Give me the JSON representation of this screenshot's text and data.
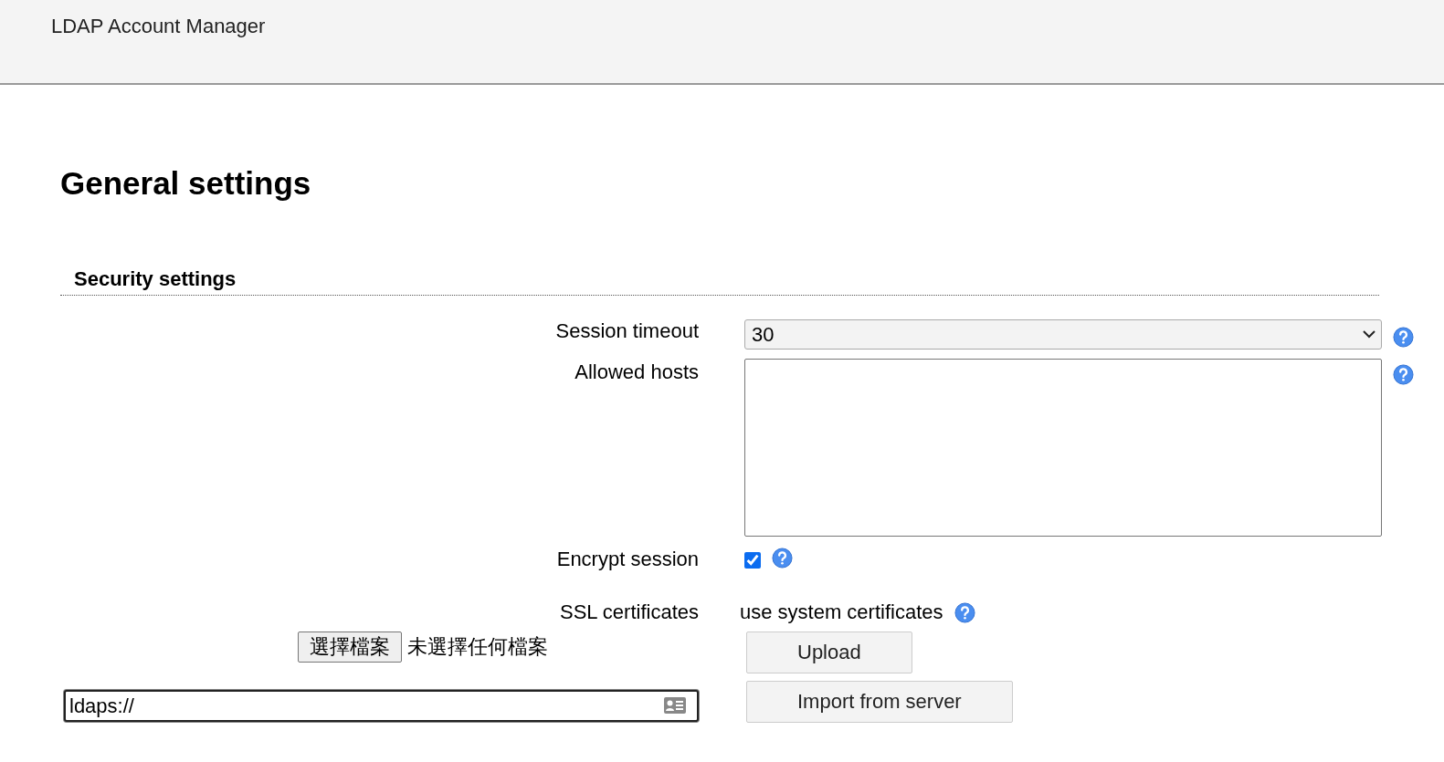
{
  "app_title": "LDAP Account Manager",
  "page_title": "General settings",
  "section_title": "Security settings",
  "settings": [
    {
      "kind": "select",
      "label": "Session timeout",
      "value": "30",
      "help": true
    },
    {
      "kind": "textarea",
      "label": "Allowed hosts",
      "help": true
    },
    {
      "kind": "checkbox",
      "label": "Encrypt session",
      "checked": true,
      "help": true
    },
    {
      "kind": "text",
      "label": "SSL certificates",
      "value": "use system certificates",
      "help": true
    }
  ],
  "file_upload": {
    "choose_button": "選擇檔案",
    "status": "未選擇任何檔案",
    "upload_button": "Upload"
  },
  "server_import": {
    "value": "ldaps://",
    "button": "Import from server"
  }
}
